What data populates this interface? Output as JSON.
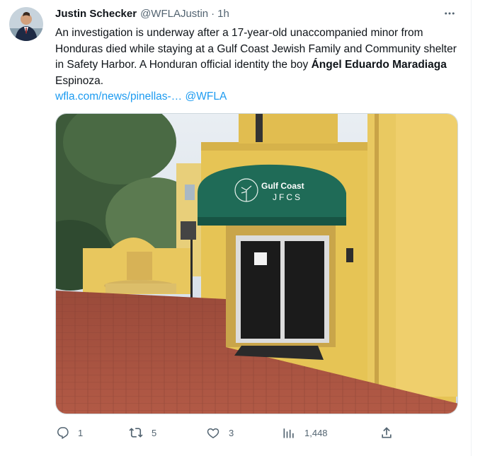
{
  "tweet": {
    "author_name": "Justin Schecker",
    "author_handle": "@WFLAJustin",
    "separator": "·",
    "time": "1h",
    "text_part1": "An investigation is underway after a 17-year-old unaccompanied minor from Honduras died while staying at a Gulf Coast Jewish Family and Community shelter in Safety Harbor. A Honduran official identity the boy ",
    "text_bold": "Ángel Eduardo Maradiaga",
    "text_part2": " Espinoza.",
    "link_url": "wfla.com/news/pinellas-…",
    "link_mention": "@WFLA",
    "awning_line1": "Gulf Coast",
    "awning_line2": "JFCS"
  },
  "actions": {
    "replies": "1",
    "retweets": "5",
    "likes": "3",
    "views": "1,448"
  },
  "icons": {
    "more": "more-dots-icon",
    "reply": "reply-icon",
    "retweet": "retweet-icon",
    "like": "heart-icon",
    "views": "views-chart-icon",
    "share": "share-icon"
  },
  "colors": {
    "accent": "#1d9bf0",
    "secondary_text": "#536471",
    "awning": "#1f6b57"
  }
}
